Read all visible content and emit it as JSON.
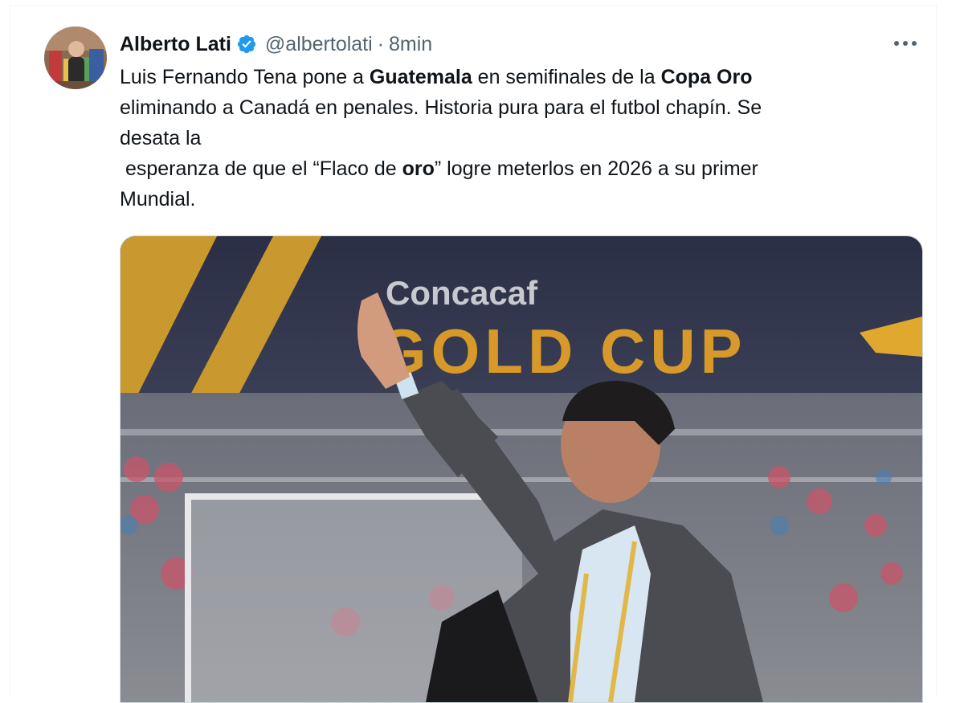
{
  "tweet": {
    "author": {
      "name": "Alberto Lati",
      "handle": "@albertolati",
      "verified": true,
      "avatar_icon": "user-avatar-photo"
    },
    "separator": "·",
    "time": "8min",
    "more_icon": "more-horizontal-icon",
    "text": {
      "line1": {
        "part1": "Luis Fernando Tena pone a ",
        "bold1": "Guatemala",
        "part2": " en semifinales de la ",
        "bold2": "Copa Oro"
      },
      "line2": "eliminando a Canadá en penales. Historia pura para el futbol chapín. Se",
      "line3": "desata la",
      "line4": {
        "part1": " esperanza de que el “Flaco de ",
        "bold": "oro",
        "part2": "” logre meterlos en 2026 a su primer"
      },
      "line5": "Mundial."
    },
    "media": {
      "description_icon": "photo-coach-waving",
      "banner_top_text": "Concacaf",
      "banner_main_text": "GOLD CUP"
    },
    "colors": {
      "verified": "#1d9bf0",
      "text": "#0f1419",
      "secondary": "#536471"
    }
  }
}
